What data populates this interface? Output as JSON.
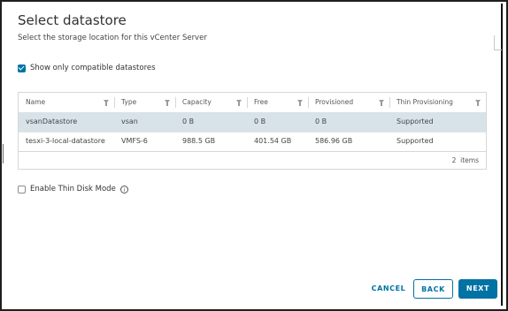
{
  "dialog": {
    "title": "Select datastore",
    "subtitle": "Select the storage location for this vCenter Server"
  },
  "compat_checkbox": {
    "label": "Show only compatible datastores",
    "checked": true
  },
  "table": {
    "columns": [
      "Name",
      "Type",
      "Capacity",
      "Free",
      "Provisioned",
      "Thin Provisioning"
    ],
    "rows": [
      [
        "vsanDatastore",
        "vsan",
        "0 B",
        "0 B",
        "0 B",
        "Supported"
      ],
      [
        "tesxi-3-local-datastore",
        "VMFS-6",
        "988.5 GB",
        "401.54 GB",
        "586.96 GB",
        "Supported"
      ]
    ],
    "selected_row": 0,
    "count": "2",
    "count_suffix": "items"
  },
  "thin_disk": {
    "label": "Enable Thin Disk Mode",
    "checked": false,
    "info_icon": "i"
  },
  "buttons": {
    "cancel": "CANCEL",
    "back": "BACK",
    "next": "NEXT"
  },
  "colors": {
    "accent": "#0072a3",
    "selected_row": "#d8e3e9"
  }
}
